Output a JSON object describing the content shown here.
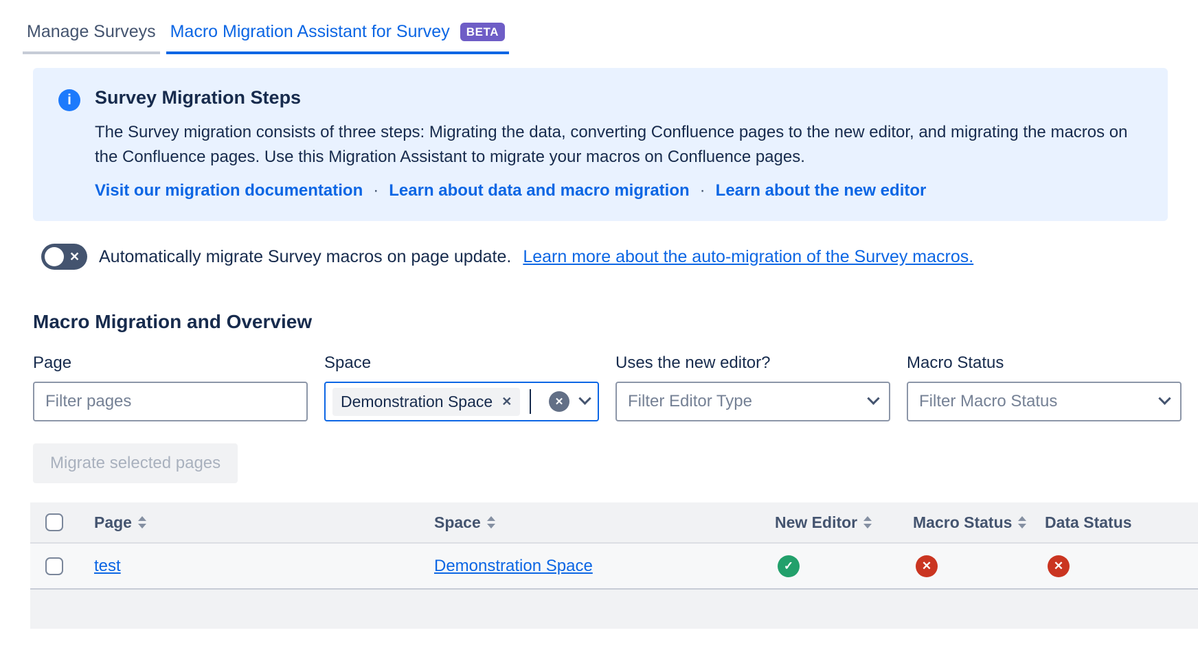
{
  "tabs": [
    {
      "label": "Manage Surveys",
      "active": false
    },
    {
      "label": "Macro Migration Assistant for Survey",
      "active": true,
      "badge": "BETA"
    }
  ],
  "banner": {
    "title": "Survey Migration Steps",
    "body": "The Survey migration consists of three steps: Migrating the data, converting Confluence pages to the new editor, and migrating the macros on the Confluence pages. Use this Migration Assistant to migrate your macros on Confluence pages.",
    "link_separator": "·",
    "links": [
      "Visit our migration documentation",
      "Learn about data and macro migration",
      "Learn about the new editor"
    ]
  },
  "auto_migration": {
    "enabled": false,
    "toggle_glyph": "✕",
    "text": "Automatically migrate Survey macros on page update.",
    "link": "Learn more about the auto-migration of the Survey macros."
  },
  "section": {
    "title": "Macro Migration and Overview"
  },
  "filters": {
    "page": {
      "label": "Page",
      "placeholder": "Filter pages",
      "value": ""
    },
    "space": {
      "label": "Space",
      "selected_chip": "Demonstration Space",
      "chip_remove_glyph": "✕",
      "clear_glyph": "✕",
      "focused": true
    },
    "editor": {
      "label": "Uses the new editor?",
      "placeholder": "Filter Editor Type"
    },
    "macro_status": {
      "label": "Macro Status",
      "placeholder": "Filter Macro Status"
    }
  },
  "migrate_button": {
    "label": "Migrate selected pages",
    "enabled": false
  },
  "table": {
    "columns": [
      {
        "label": "Page",
        "sortable": true
      },
      {
        "label": "Space",
        "sortable": true
      },
      {
        "label": "New Editor",
        "sortable": true
      },
      {
        "label": "Macro Status",
        "sortable": true
      },
      {
        "label": "Data Status",
        "sortable": false
      }
    ],
    "rows": [
      {
        "page": "test",
        "space": "Demonstration Space",
        "new_editor": "success",
        "macro_status": "error",
        "data_status": "error",
        "selected": false
      }
    ]
  },
  "icons": {
    "info": "info-icon",
    "pass_glyph": "✓",
    "fail_glyph": "✕"
  },
  "colors": {
    "accent_blue": "#0C66E4",
    "info_blue": "#1D7AFC",
    "banner_bg": "#E9F2FF",
    "beta_purple": "#6E5DC6",
    "success_green": "#22A06B",
    "error_red": "#CA3521",
    "toggle_off": "#44546F",
    "table_header_bg": "#F1F2F4",
    "text_dark": "#172B4D"
  }
}
